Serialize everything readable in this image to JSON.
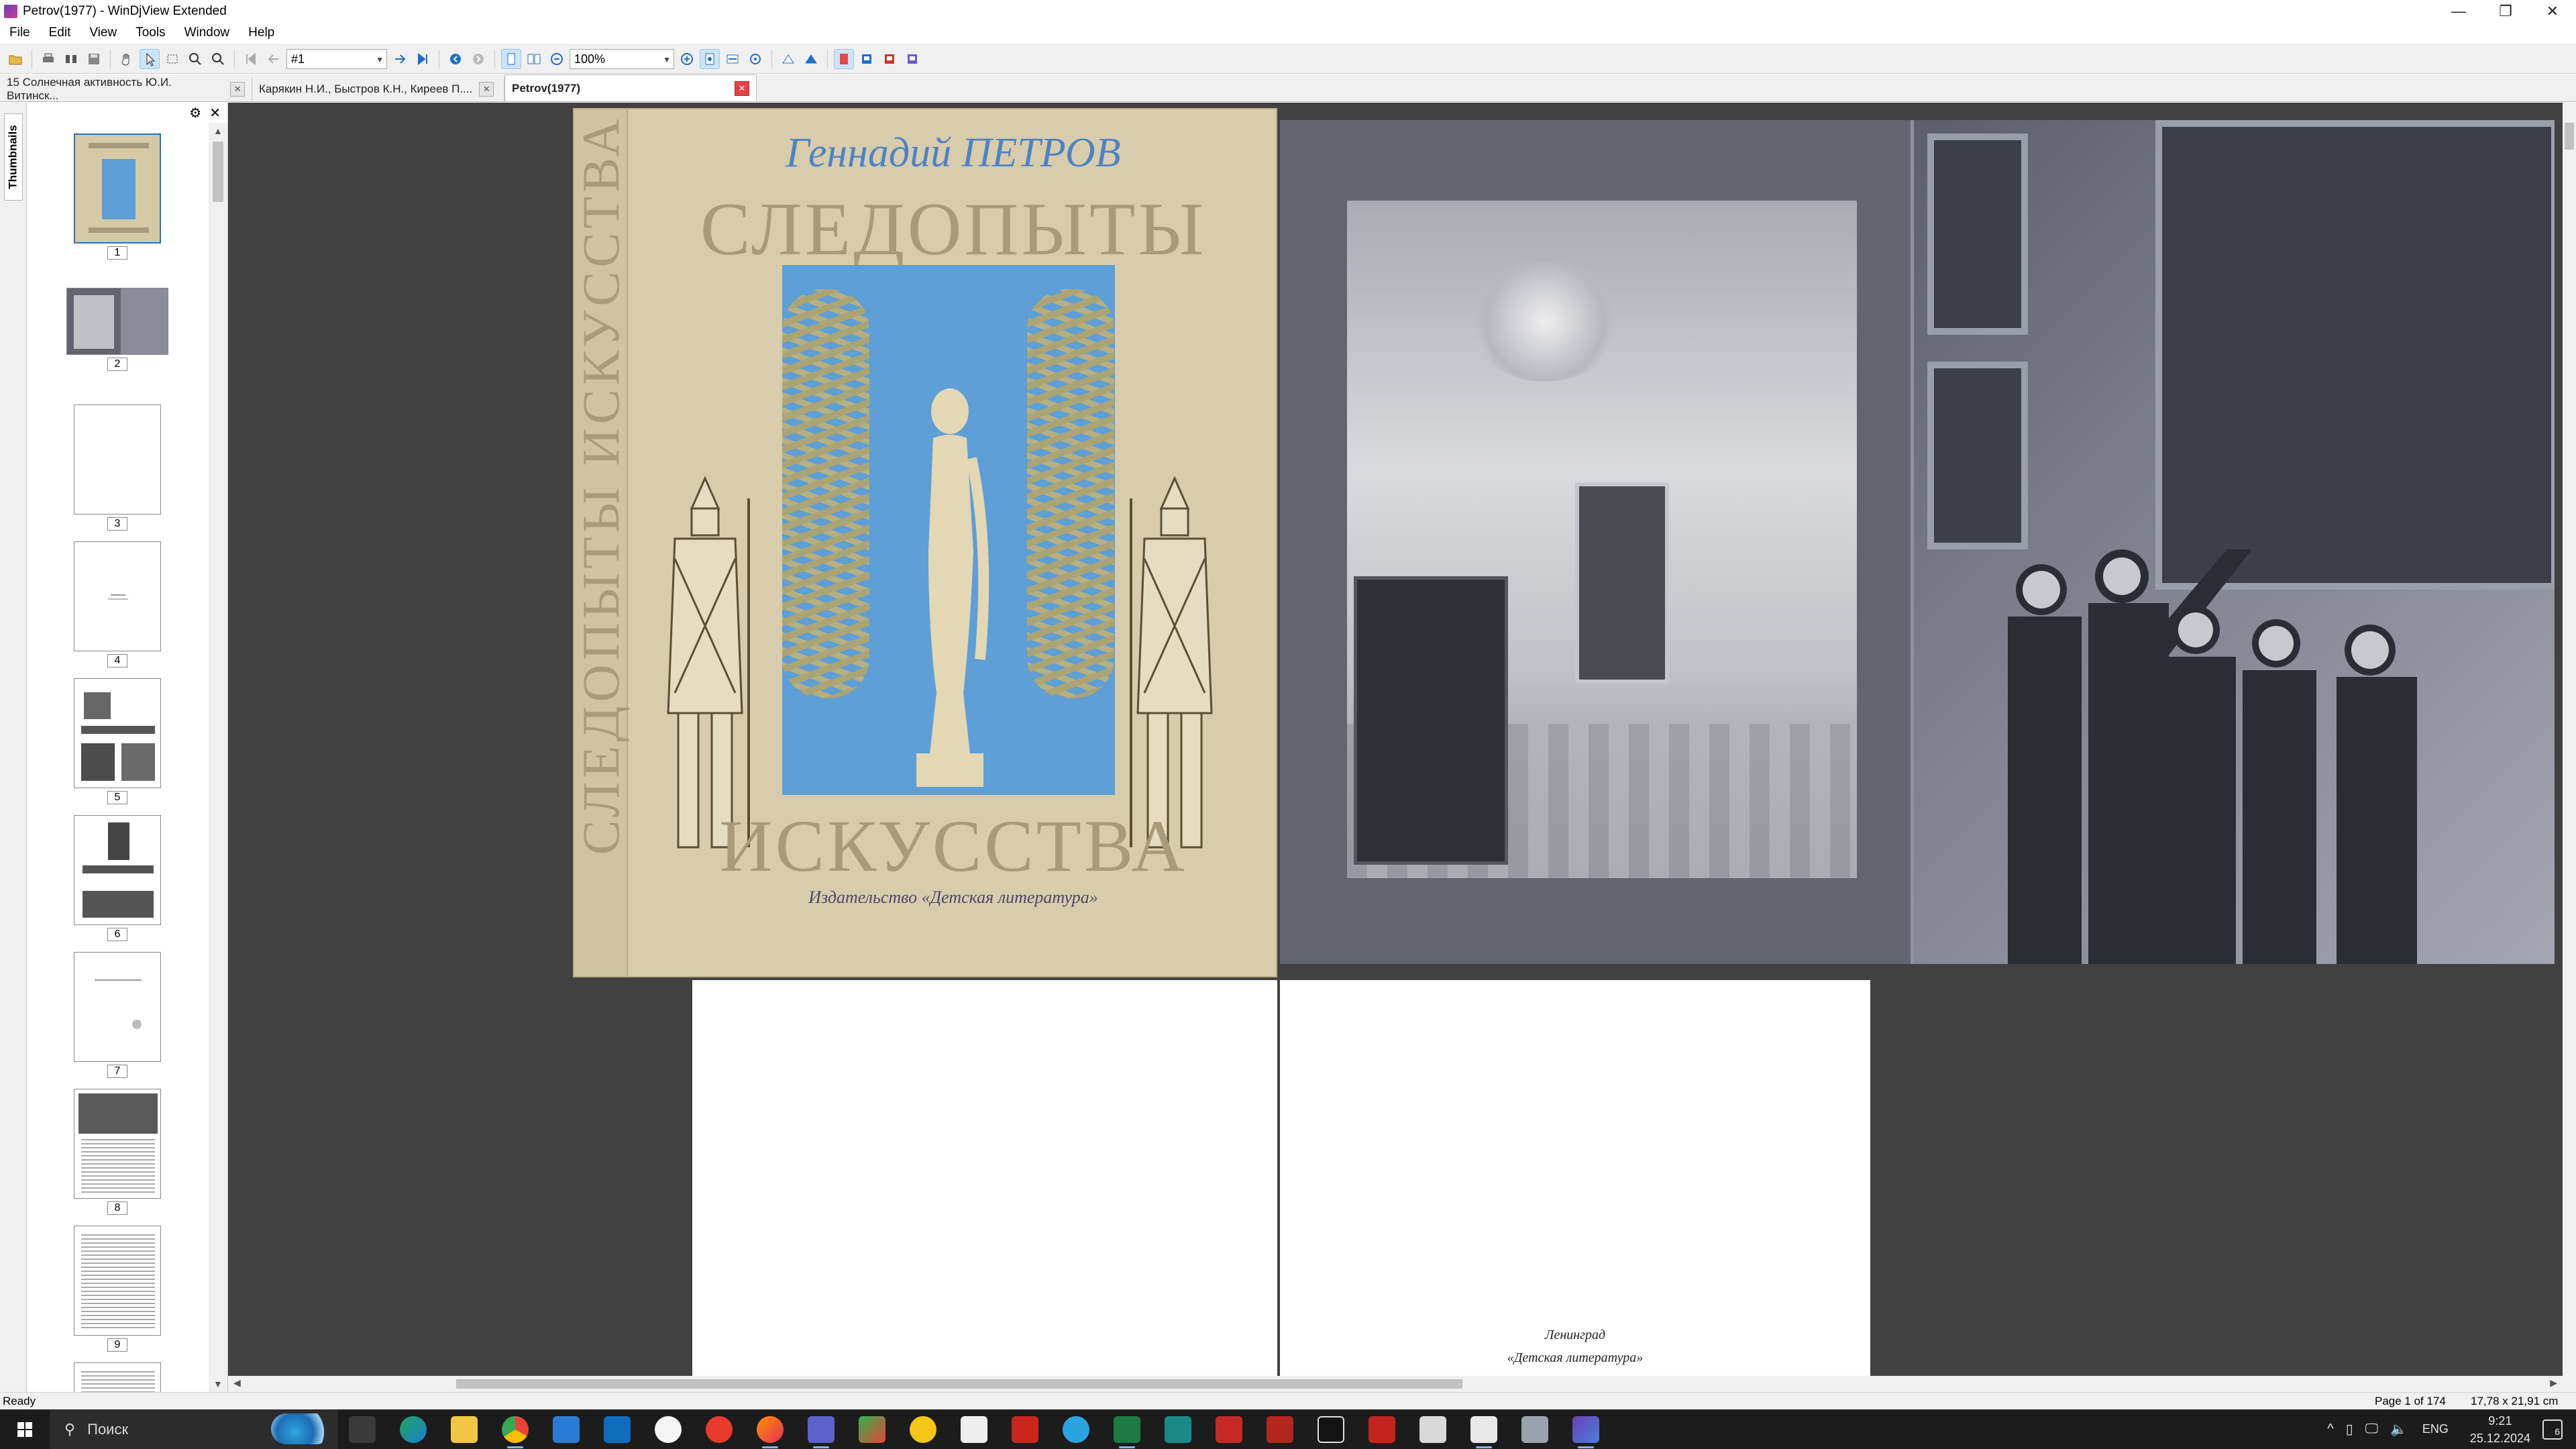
{
  "window": {
    "title": "Petrov(1977) - WinDjView Extended",
    "buttons": {
      "minimize": "—",
      "restore": "❐",
      "close": "✕"
    }
  },
  "menu": {
    "items": [
      "File",
      "Edit",
      "View",
      "Tools",
      "Window",
      "Help"
    ]
  },
  "toolbar": {
    "page_combo": "#1",
    "zoom_combo": "100%",
    "icons": [
      "open-icon",
      "print-icon",
      "find-icon",
      "save-icon",
      "hand-tool-icon",
      "select-tool-icon",
      "rect-select-icon",
      "zoom-in-tool-icon",
      "zoom-out-tool-icon",
      "first-page-icon",
      "prev-page-icon",
      "next-page-icon",
      "last-page-icon",
      "back-icon",
      "forward-icon",
      "single-page-icon",
      "facing-pages-icon",
      "zoom-out-icon",
      "zoom-in-icon",
      "fit-page-icon",
      "fit-width-icon",
      "actual-size-icon",
      "rotate-left-icon",
      "rotate-right-icon",
      "bookmark-icon",
      "color-icon",
      "contrast-icon",
      "settings-icon"
    ]
  },
  "tabs": [
    {
      "label": "15 Солнечная активность Ю.И. Витинск...",
      "active": false
    },
    {
      "label": "Карякин Н.И., Быстров К.Н., Киреев П....",
      "active": false
    },
    {
      "label": "Petrov(1977)",
      "active": true
    }
  ],
  "sidebar": {
    "tab_label": "Thumbnails",
    "thumbnails": [
      {
        "number": "1",
        "kind": "cover"
      },
      {
        "number": "2",
        "kind": "photo"
      },
      {
        "number": "3",
        "kind": "blank"
      },
      {
        "number": "4",
        "kind": "text-small"
      },
      {
        "number": "5",
        "kind": "title-spread"
      },
      {
        "number": "6",
        "kind": "title-page"
      },
      {
        "number": "7",
        "kind": "text-small"
      },
      {
        "number": "8",
        "kind": "text-photo"
      },
      {
        "number": "9",
        "kind": "text"
      }
    ]
  },
  "document": {
    "cover": {
      "author": "Геннадий ПЕТРОВ",
      "title": "СЛЕДОПЫТЫ",
      "subtitle": "ИСКУССТВА",
      "spine": "СЛЕДОПЫТЫ ИСКУССТВА",
      "publisher": "Издательство «Детская литература»"
    },
    "imprint": {
      "city": "Ленинград",
      "publisher": "«Детская литература»"
    }
  },
  "status": {
    "left": "Ready",
    "page": "Page 1 of 174",
    "size": "17,78 x 21,91 cm"
  },
  "taskbar": {
    "search_placeholder": "Поиск",
    "apps": [
      "task-view",
      "edge",
      "explorer",
      "chrome",
      "store",
      "outlook",
      "yandex",
      "yandex-browser",
      "firefox",
      "djvu-saver",
      "maps",
      "norton",
      "notes",
      "mail-red",
      "telegram",
      "excel",
      "terminal",
      "acrobat",
      "snap",
      "reader",
      "filezilla",
      "scanner",
      "windjview",
      "tablet",
      "app-purple"
    ],
    "lang": "ENG",
    "time": "9:21",
    "date": "25.12.2024",
    "notifications": "6"
  }
}
